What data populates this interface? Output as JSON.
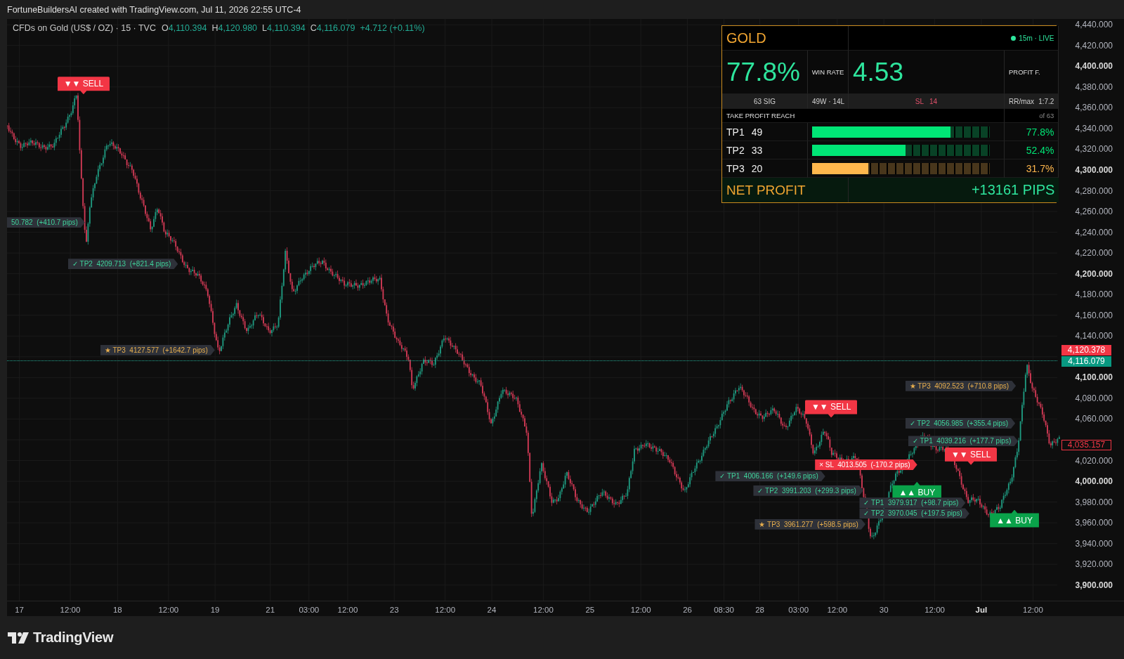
{
  "snapshot_header": {
    "text": "FortuneBuildersAI created with TradingView.com, Jul 11, 2026 22:55 UTC-4"
  },
  "legend": {
    "symbol": "CFDs on Gold (US$ / OZ) · 15 · TVC",
    "ohlc": [
      {
        "label": "O",
        "value": "4,110.394"
      },
      {
        "label": "H",
        "value": "4,120.980"
      },
      {
        "label": "L",
        "value": "4,110.394"
      },
      {
        "label": "C",
        "value": "4,116.079"
      }
    ],
    "change": "+4.712 (+0.11%)"
  },
  "stats_panel": {
    "title": "GOLD",
    "status": "15m · LIVE",
    "win_rate": "77.8%",
    "win_rate_label": "WIN RATE",
    "profit_factor": "4.53",
    "profit_factor_label": "PROFIT F.",
    "signals": "63 SIG",
    "record": "49W · 14L",
    "stop_loss": {
      "label": "SL",
      "value": "14"
    },
    "risk_reward": {
      "label": "RR/max",
      "value": "1:7.2"
    },
    "reach_title": "TAKE PROFIT REACH",
    "reach_total": "of 63",
    "targets": [
      {
        "name": "TP1",
        "count": "49",
        "level": 0.778,
        "percent": "77.8%",
        "color": "#00e676"
      },
      {
        "name": "TP2",
        "count": "33",
        "level": 0.524,
        "percent": "52.4%",
        "color": "#00e676"
      },
      {
        "name": "TP3",
        "count": "20",
        "level": 0.317,
        "percent": "31.7%",
        "color": "#ffb74d"
      }
    ],
    "net_profit_label": "NET PROFIT",
    "net_profit": "+13161 PIPS"
  },
  "annotations": [
    {
      "kind": "sell",
      "text": "▼▼ SELL"
    },
    {
      "kind": "tp",
      "text": "50.782  (+410.7 pips)"
    },
    {
      "kind": "tp",
      "text": "✓ TP2  4209.713  (+821.4 pips)"
    },
    {
      "kind": "tp3",
      "text": "★ TP3  4127.577  (+1642.7 pips)"
    },
    {
      "kind": "tp3",
      "text": "★ TP3  4092.523  (+710.8 pips)"
    },
    {
      "kind": "sell",
      "text": "▼▼ SELL"
    },
    {
      "kind": "tp",
      "text": "✓ TP2  4056.985  (+355.4 pips)"
    },
    {
      "kind": "tp",
      "text": "✓ TP1  4039.216  (+177.7 pips)"
    },
    {
      "kind": "sell",
      "text": "▼▼ SELL"
    },
    {
      "kind": "sl",
      "text": "× SL  4013.505  (-170.2 pips)"
    },
    {
      "kind": "tp",
      "text": "✓ TP1  4006.166  (+149.6 pips)"
    },
    {
      "kind": "buy",
      "text": "▲▲ BUY"
    },
    {
      "kind": "tp",
      "text": "✓ TP2  3991.203  (+299.3 pips)"
    },
    {
      "kind": "tp",
      "text": "✓ TP1  3979.917  (+98.7 pips)"
    },
    {
      "kind": "tp",
      "text": "✓ TP2  3970.045  (+197.5 pips)"
    },
    {
      "kind": "tp3",
      "text": "★ TP3  3961.277  (+598.5 pips)"
    },
    {
      "kind": "buy",
      "text": "▲▲ BUY"
    }
  ],
  "price_axis": {
    "labels": [
      {
        "text": "4,440.000",
        "major": false
      },
      {
        "text": "4,420.000",
        "major": false
      },
      {
        "text": "4,400.000",
        "major": true
      },
      {
        "text": "4,380.000",
        "major": false
      },
      {
        "text": "4,360.000",
        "major": false
      },
      {
        "text": "4,340.000",
        "major": false
      },
      {
        "text": "4,320.000",
        "major": false
      },
      {
        "text": "4,300.000",
        "major": true
      },
      {
        "text": "4,280.000",
        "major": false
      },
      {
        "text": "4,260.000",
        "major": false
      },
      {
        "text": "4,240.000",
        "major": false
      },
      {
        "text": "4,220.000",
        "major": false
      },
      {
        "text": "4,200.000",
        "major": true
      },
      {
        "text": "4,180.000",
        "major": false
      },
      {
        "text": "4,160.000",
        "major": false
      },
      {
        "text": "4,140.000",
        "major": false
      },
      {
        "text": "4,100.000",
        "major": true
      },
      {
        "text": "4,080.000",
        "major": false
      },
      {
        "text": "4,060.000",
        "major": false
      },
      {
        "text": "4,020.000",
        "major": false
      },
      {
        "text": "4,000.000",
        "major": true
      },
      {
        "text": "3,980.000",
        "major": false
      },
      {
        "text": "3,960.000",
        "major": false
      },
      {
        "text": "3,940.000",
        "major": false
      },
      {
        "text": "3,920.000",
        "major": false
      },
      {
        "text": "3,900.000",
        "major": true
      }
    ],
    "markers": [
      {
        "kind": "filled",
        "text": "4,120.378",
        "color": "#f23645"
      },
      {
        "kind": "filled",
        "text": "4,116.079",
        "color": "#089981"
      },
      {
        "kind": "outline",
        "text": "4,035.157",
        "color": "#f23645"
      }
    ]
  },
  "time_axis": {
    "labels": [
      {
        "text": "17",
        "major": false
      },
      {
        "text": "12:00",
        "major": false
      },
      {
        "text": "18",
        "major": false
      },
      {
        "text": "12:00",
        "major": false
      },
      {
        "text": "19",
        "major": false
      },
      {
        "text": "21",
        "major": false
      },
      {
        "text": "03:00",
        "major": false
      },
      {
        "text": "12:00",
        "major": false
      },
      {
        "text": "23",
        "major": false
      },
      {
        "text": "12:00",
        "major": false
      },
      {
        "text": "24",
        "major": false
      },
      {
        "text": "12:00",
        "major": false
      },
      {
        "text": "25",
        "major": false
      },
      {
        "text": "12:00",
        "major": false
      },
      {
        "text": "26",
        "major": false
      },
      {
        "text": "08:30",
        "major": false
      },
      {
        "text": "28",
        "major": false
      },
      {
        "text": "03:00",
        "major": false
      },
      {
        "text": "12:00",
        "major": false
      },
      {
        "text": "30",
        "major": false
      },
      {
        "text": "12:00",
        "major": false
      },
      {
        "text": "Jul",
        "major": true
      },
      {
        "text": "12:00",
        "major": false
      }
    ]
  },
  "footer": {
    "brand": "TradingView"
  }
}
